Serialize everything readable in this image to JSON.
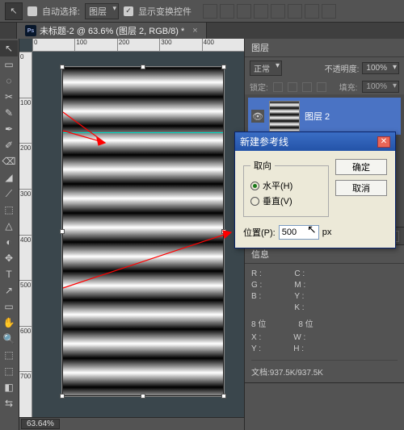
{
  "options": {
    "auto_select_label": "自动选择:",
    "auto_select_checked": false,
    "auto_select_target": "图层",
    "transform_controls_label": "显示变换控件",
    "transform_controls_checked": true
  },
  "document": {
    "tab_title": "未标题-2 @ 63.6% (图层 2, RGB/8) *",
    "zoom_status": "63.64%"
  },
  "ruler_top_ticks": [
    "0",
    "100",
    "200",
    "300",
    "400"
  ],
  "ruler_left_ticks": [
    "0",
    "100",
    "200",
    "300",
    "400",
    "500",
    "600",
    "700"
  ],
  "tools": [
    "↖",
    "▭",
    "◌",
    "✂",
    "✎",
    "✒",
    "✐",
    "⌫",
    "◢",
    "⟋",
    "⬚",
    "△",
    "◐",
    "✥",
    "T",
    "↗",
    "▭",
    "✋",
    "🔍",
    "⬚",
    "⬚",
    "◧",
    "⇆"
  ],
  "layers_panel": {
    "title": "图层",
    "blend_mode": "正常",
    "opacity_label": "不透明度:",
    "opacity_value": "100%",
    "lock_label": "锁定:",
    "fill_label": "填充:",
    "fill_value": "100%",
    "layer_name": "图层 2"
  },
  "dialog": {
    "title": "新建参考线",
    "group_label": "取向",
    "radio_horizontal": "水平(H)",
    "radio_vertical": "垂直(V)",
    "horizontal_selected": true,
    "position_label": "位置(P):",
    "position_value": "500",
    "position_unit": "px",
    "ok": "确定",
    "cancel": "取消"
  },
  "info_panel": {
    "title": "信息",
    "r": "R :",
    "g": "G :",
    "b": "B :",
    "c": "C :",
    "m": "M :",
    "y": "Y :",
    "k": "K :",
    "bits": "8 位",
    "x": "X :",
    "yv": "Y :",
    "w": "W :",
    "h": "H :",
    "docsize": "文档:937.5K/937.5K"
  }
}
